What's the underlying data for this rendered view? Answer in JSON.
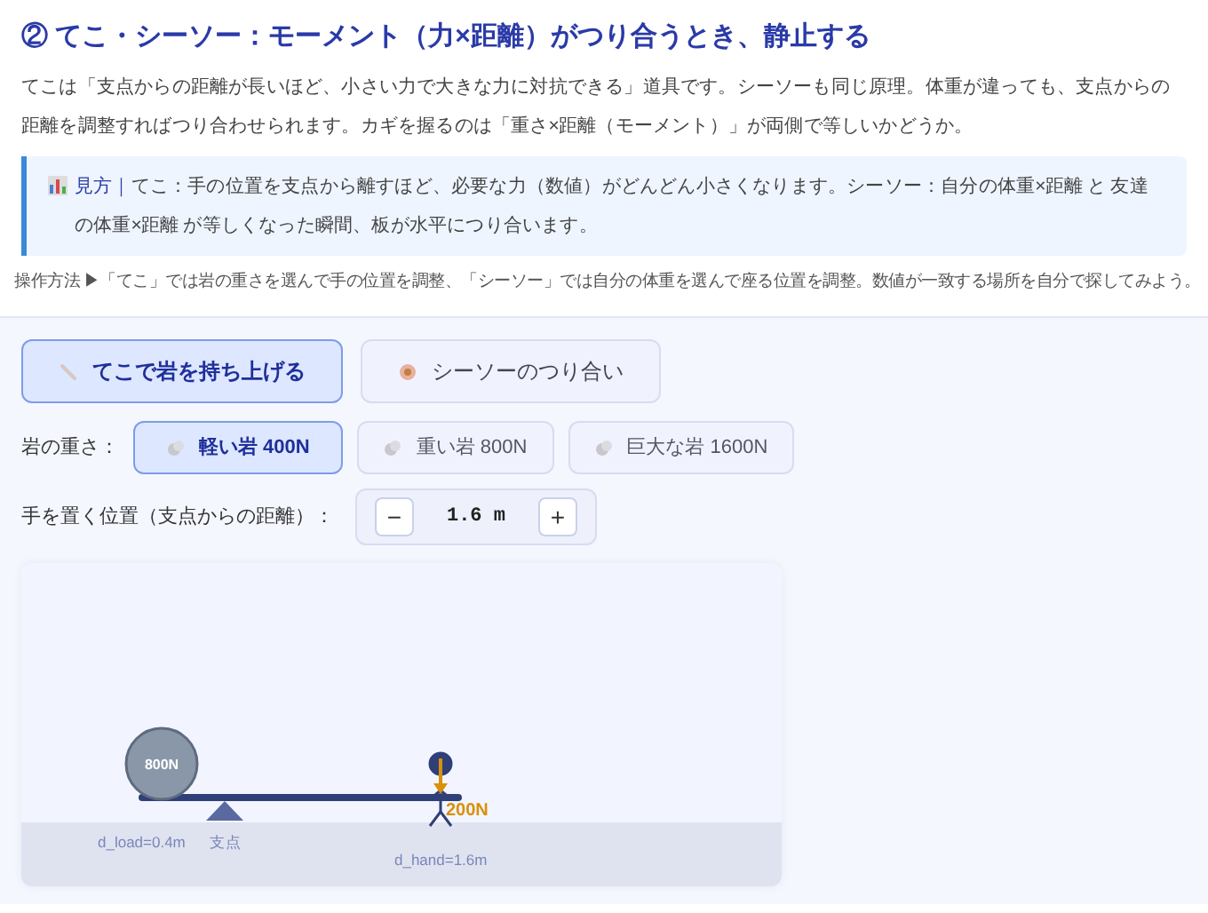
{
  "title": "② てこ・シーソー：モーメント（力×距離）がつり合うとき、静止する",
  "intro": "てこは「支点からの距離が長いほど、小さい力で大きな力に対抗できる」道具です。シーソーも同じ原理。体重が違っても、支点からの距離を調整すればつり合わせられます。カギを握るのは「重さ×距離（モーメント）」が両側で等しいかどうか。",
  "hint": {
    "label": "見方｜",
    "text": "てこ：手の位置を支点から離すほど、必要な力（数値）がどんどん小さくなります。シーソー：自分の体重×距離 と 友達の体重×距離 が等しくなった瞬間、板が水平につり合います。"
  },
  "instructions": "操作方法 ▶「てこ」では岩の重さを選んで手の位置を調整、「シーソー」では自分の体重を選んで座る位置を調整。数値が一致する場所を自分で探してみよう。",
  "modes": [
    {
      "label": "てこで岩を持ち上げる",
      "kind": "lever",
      "selected": true
    },
    {
      "label": "シーソーのつり合い",
      "kind": "seesaw",
      "selected": false
    }
  ],
  "weight": {
    "label": "岩の重さ：",
    "options": [
      {
        "label": "軽い岩 400N",
        "selected": true
      },
      {
        "label": "重い岩 800N",
        "selected": false
      },
      {
        "label": "巨大な岩 1600N",
        "selected": false
      }
    ]
  },
  "position": {
    "label": "手を置く位置（支点からの距離）：",
    "minus": "−",
    "value": "1.6 m",
    "plus": "+"
  },
  "diagram": {
    "rock_label": "800N",
    "force_label": "200N",
    "load_distance": "d_load=0.4m",
    "fulcrum_label": "支点",
    "hand_distance": "d_hand=1.6m"
  }
}
